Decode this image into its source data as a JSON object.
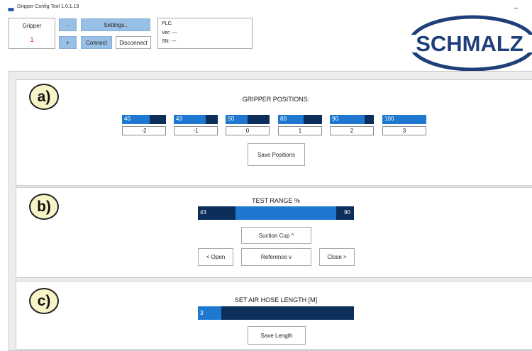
{
  "window": {
    "title": "Gripper Config Tool 1.0.1.19",
    "minimize": "–"
  },
  "gripper": {
    "label": "Gripper",
    "value": "1"
  },
  "controls": {
    "minus": "-",
    "plus": "+",
    "settings": "Settings..",
    "connect": "Connect",
    "disconnect": "Disconnect"
  },
  "info": {
    "plc": "PLC:",
    "ver": "Ver: ---",
    "sn": "SN: ---"
  },
  "logo": {
    "text": "SCHMALZ"
  },
  "sections": {
    "a": {
      "badge": "a)",
      "title": "GRIPPER POSITIONS:",
      "positions": [
        {
          "value": "40",
          "fill": 0.63,
          "index": "-2"
        },
        {
          "value": "43",
          "fill": 0.73,
          "index": "-1"
        },
        {
          "value": "50",
          "fill": 0.5,
          "index": "0"
        },
        {
          "value": "80",
          "fill": 0.58,
          "index": "1"
        },
        {
          "value": "90",
          "fill": 0.79,
          "index": "2"
        },
        {
          "value": "100",
          "fill": 1.0,
          "index": "3"
        }
      ],
      "save": "Save Positions"
    },
    "b": {
      "badge": "b)",
      "title": "TEST RANGE %",
      "range_min": "43",
      "range_max": "90",
      "suction": "Suction Cup ^",
      "open": "< Open",
      "reference": "Reference v",
      "close": "Close >"
    },
    "c": {
      "badge": "c)",
      "title": "SET AIR HOSE LENGTH [M]",
      "hose_value": "3",
      "hose_fill": 0.15,
      "save": "Save Length"
    }
  },
  "colors": {
    "bar_dark": "#0c2e5b",
    "bar_light": "#1e78d0",
    "button_blue": "#98bfe6",
    "logo_navy": "#1f3f7a",
    "gripper_value": "#e02020"
  }
}
